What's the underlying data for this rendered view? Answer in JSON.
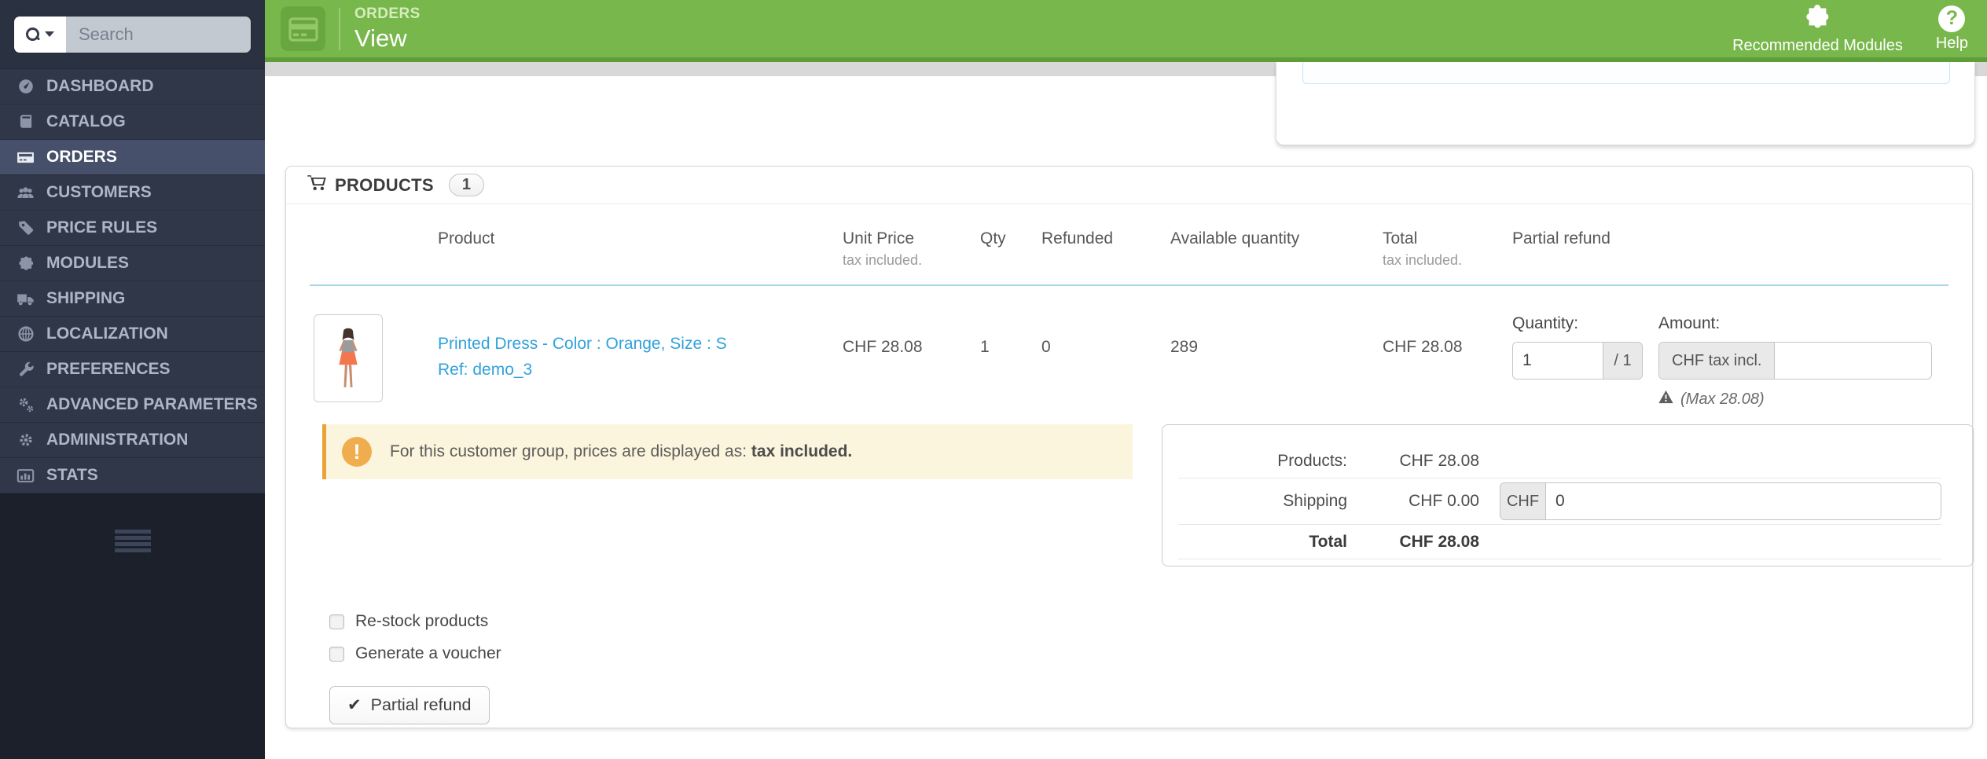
{
  "colors": {
    "accent_green": "#78b74c",
    "accent_green_dark": "#5d9e38",
    "link_blue": "#30a2da",
    "warning_orange": "#f0ad4e",
    "sidebar_bg": "#303748",
    "selected_item_bg": "#46506a"
  },
  "sidebar": {
    "search_placeholder": "Search",
    "items": [
      {
        "label": "DASHBOARD",
        "icon": "dashboard-icon"
      },
      {
        "label": "CATALOG",
        "icon": "catalog-icon"
      },
      {
        "label": "ORDERS",
        "icon": "orders-icon",
        "active": true
      },
      {
        "label": "CUSTOMERS",
        "icon": "customers-icon"
      },
      {
        "label": "PRICE RULES",
        "icon": "price-rules-icon"
      },
      {
        "label": "MODULES",
        "icon": "modules-icon"
      },
      {
        "label": "SHIPPING",
        "icon": "shipping-icon"
      },
      {
        "label": "LOCALIZATION",
        "icon": "localization-icon"
      },
      {
        "label": "PREFERENCES",
        "icon": "preferences-icon"
      },
      {
        "label": "ADVANCED PARAMETERS",
        "icon": "advanced-parameters-icon"
      },
      {
        "label": "ADMINISTRATION",
        "icon": "administration-icon"
      },
      {
        "label": "STATS",
        "icon": "stats-icon"
      }
    ]
  },
  "header": {
    "section": "ORDERS",
    "title": "View",
    "actions": {
      "recommended_modules": "Recommended Modules",
      "help": "Help"
    }
  },
  "panel": {
    "title": "PRODUCTS",
    "count": "1",
    "table": {
      "headers": {
        "product": "Product",
        "unit_price": "Unit Price",
        "unit_price_sub": "tax included.",
        "qty": "Qty",
        "refunded": "Refunded",
        "available": "Available quantity",
        "total": "Total",
        "total_sub": "tax included.",
        "partial_refund": "Partial refund"
      },
      "row": {
        "name": "Printed Dress - Color : Orange, Size : S",
        "ref": "Ref: demo_3",
        "unit_price": "CHF 28.08",
        "qty": "1",
        "refunded": "0",
        "available": "289",
        "total": "CHF 28.08"
      }
    },
    "refund": {
      "quantity_label": "Quantity:",
      "quantity_value": "1",
      "quantity_max": "/ 1",
      "amount_label": "Amount:",
      "amount_addon": "CHF tax incl.",
      "amount_value": "",
      "max_note": "(Max 28.08)"
    },
    "notice": {
      "text": "For this customer group, prices are displayed as:",
      "bold": "tax included."
    },
    "totals": {
      "products_label": "Products:",
      "products_value": "CHF 28.08",
      "shipping_label": "Shipping",
      "shipping_value": "CHF 0.00",
      "shipping_addon": "CHF",
      "shipping_input": "0",
      "total_label": "Total",
      "total_value": "CHF 28.08"
    },
    "options": {
      "restock": "Re-stock products",
      "voucher": "Generate a voucher"
    },
    "submit": "Partial refund"
  }
}
